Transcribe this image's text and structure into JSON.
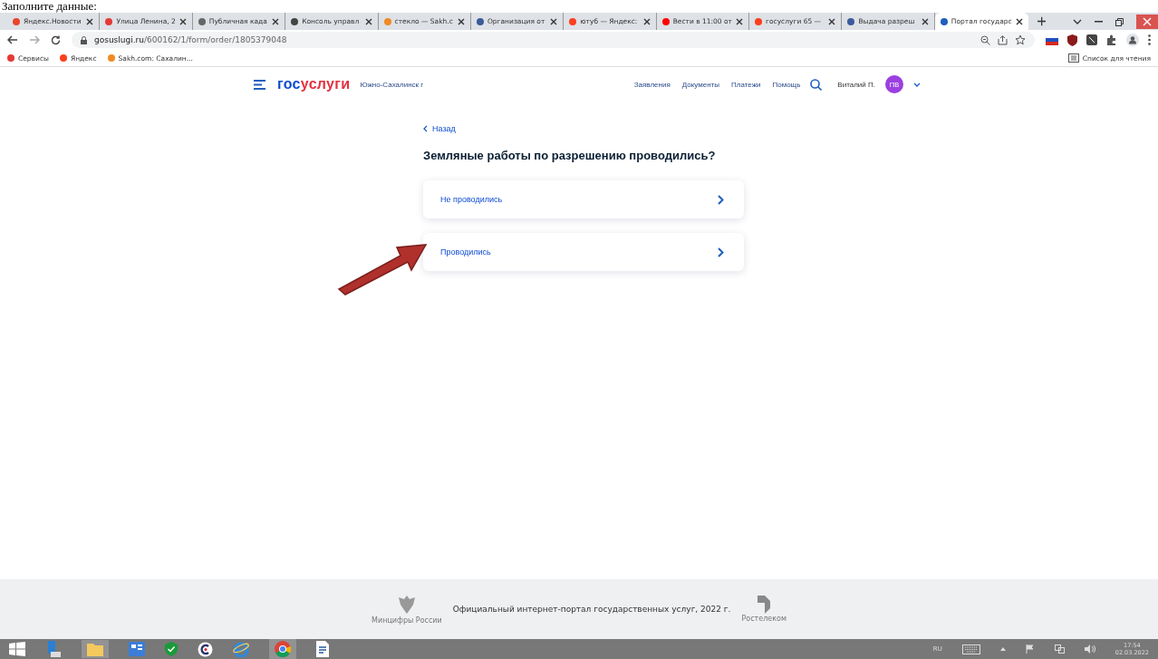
{
  "caption": "Заполните данные:",
  "browser": {
    "tabs": [
      {
        "title": "Яндекс.Новости",
        "color": "#e8452c",
        "selected": false
      },
      {
        "title": "Улица Ленина, 2",
        "color": "#e53935",
        "selected": false
      },
      {
        "title": "Публичная када",
        "color": "#666666",
        "selected": false
      },
      {
        "title": "Консоль управл",
        "color": "#444444",
        "selected": false
      },
      {
        "title": "стекло — Sakh.c",
        "color": "#f08a24",
        "selected": false
      },
      {
        "title": "Организация от",
        "color": "#3b5b9a",
        "selected": false
      },
      {
        "title": "ютуб — Яндекс:",
        "color": "#fc3f1d",
        "selected": false
      },
      {
        "title": "Вести в 11:00 от",
        "color": "#ff0000",
        "selected": false
      },
      {
        "title": "госуслуги 65 — ",
        "color": "#fc3f1d",
        "selected": false
      },
      {
        "title": "Выдача разреш",
        "color": "#3b5b9a",
        "selected": false
      },
      {
        "title": "Портал государс",
        "color": "#1f5fbf",
        "selected": true
      }
    ],
    "url_host": "gosuslugi.ru",
    "url_path": "/600162/1/form/order/1805379048",
    "bookmarks": [
      {
        "label": "Сервисы",
        "color": "#e53935"
      },
      {
        "label": "Яндекс",
        "color": "#fc3f1d"
      },
      {
        "label": "Sakh.com: Сахалин...",
        "color": "#f08a24"
      }
    ],
    "reading_list": "Список для чтения"
  },
  "site": {
    "logo_a": "гос",
    "logo_b": "услуги",
    "city": "Южно-Сахалинск г",
    "nav": [
      "Заявления",
      "Документы",
      "Платежи",
      "Помощь"
    ],
    "user": "Виталий П.",
    "initials": "ПВ"
  },
  "back": "Назад",
  "question": "Земляные работы по разрешению проводились?",
  "options": [
    {
      "label": "Не проводились"
    },
    {
      "label": "Проводились"
    }
  ],
  "footer": {
    "ministry": "Минцифры России",
    "text": "Официальный интернет-портал государственных услуг, 2022 г.",
    "operator": "Ростелеком"
  },
  "taskbar": {
    "lang": "RU",
    "time": "17:54",
    "date": "02.03.2022"
  }
}
